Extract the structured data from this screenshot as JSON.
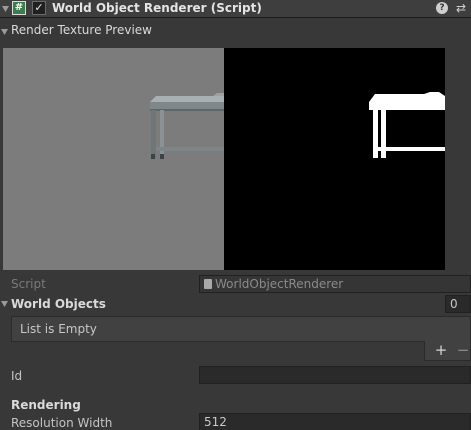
{
  "component": {
    "title": "World Object Renderer (Script)",
    "script_icon": "#",
    "enabled_check": "✓",
    "help_icon": "?",
    "settings_icon": "⇄"
  },
  "preview": {
    "title": "Render Texture Preview"
  },
  "fields": {
    "script_label": "Script",
    "script_value": "WorldObjectRenderer",
    "world_objects_label": "World Objects",
    "world_objects_count": "0",
    "list_empty": "List is Empty",
    "add_label": "+",
    "remove_label": "−",
    "id_label": "Id",
    "id_value": "",
    "rendering_header": "Rendering",
    "resolution_width_label": "Resolution Width",
    "resolution_width_value": "512"
  }
}
